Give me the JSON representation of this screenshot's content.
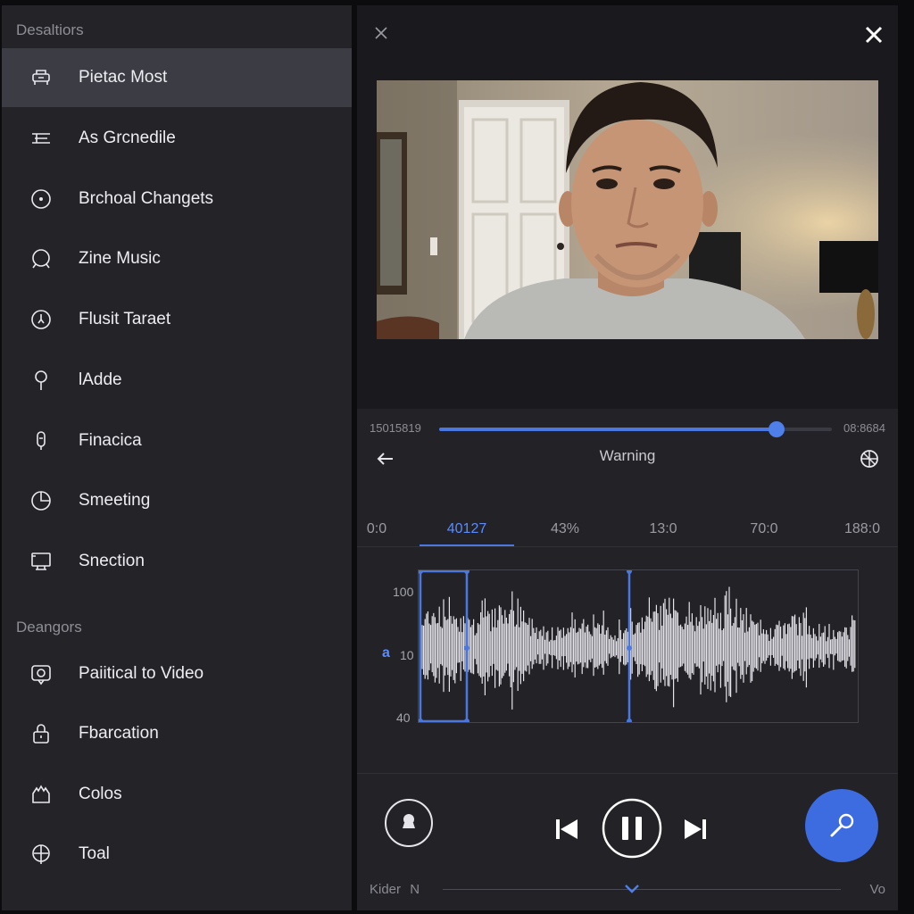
{
  "sidebar": {
    "section1_label": "Desaltiors",
    "section2_label": "Deangors",
    "items": [
      {
        "label": "Pietac Most",
        "icon": "layers-icon",
        "active": true
      },
      {
        "label": "As Grcnedile",
        "icon": "list-icon"
      },
      {
        "label": "Brchoal Changets",
        "icon": "circle-icon"
      },
      {
        "label": "Zine Music",
        "icon": "search-icon"
      },
      {
        "label": "Flusit Taraet",
        "icon": "clock-icon"
      },
      {
        "label": "lAdde",
        "icon": "pin-icon"
      },
      {
        "label": "Finacica",
        "icon": "microphone-icon"
      },
      {
        "label": "Smeeting",
        "icon": "pie-chart-icon"
      },
      {
        "label": "Snection",
        "icon": "monitor-icon"
      },
      {
        "label": "Paiitical to Video",
        "icon": "face-badge-icon"
      },
      {
        "label": "Fbarcation",
        "icon": "lock-icon"
      },
      {
        "label": "Colos",
        "icon": "hand-icon"
      },
      {
        "label": "Toal",
        "icon": "globe-icon"
      }
    ]
  },
  "editor": {
    "time_start": "15015819",
    "time_end": "08:8684",
    "scrub_progress": 0.86,
    "title": "Warning",
    "timeline_ticks": [
      {
        "label": "0:0",
        "active": false
      },
      {
        "label": "40127",
        "active": true
      },
      {
        "label": "43%",
        "active": false
      },
      {
        "label": "13:0",
        "active": false
      },
      {
        "label": "70:0",
        "active": false
      },
      {
        "label": "188:0",
        "active": false
      }
    ],
    "waveform": {
      "y_labels": [
        "100",
        "10",
        "40"
      ],
      "channel_tag": "a"
    },
    "bottom_left": "Kider",
    "bottom_left_suffix": "N",
    "bottom_right": "Vo"
  },
  "colors": {
    "accent": "#4a78e0",
    "panel": "#1a1a1e",
    "sidebar": "#232328"
  }
}
